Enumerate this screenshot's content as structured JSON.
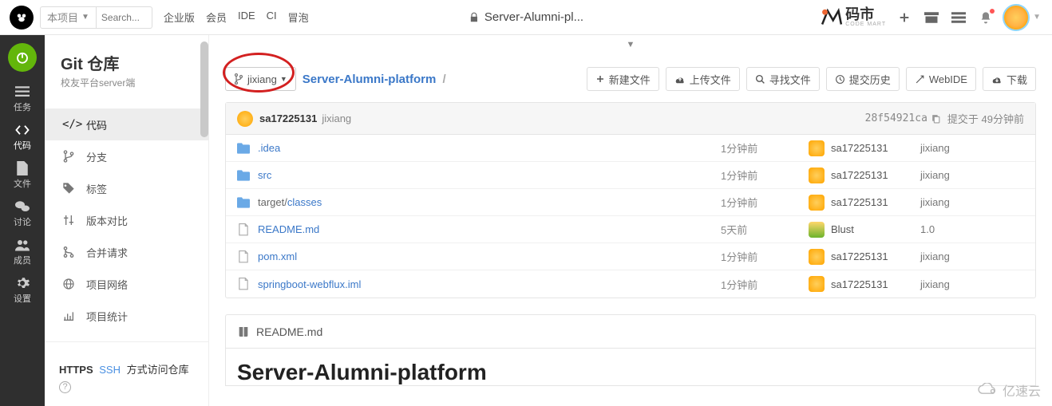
{
  "header": {
    "project_selector": "本项目",
    "search_placeholder": "Search...",
    "nav": [
      "企业版",
      "会员",
      "IDE",
      "CI",
      "冒泡"
    ],
    "title": "Server-Alumni-pl...",
    "market_label": "码市",
    "market_sub": "CODE MART"
  },
  "rail": {
    "items": [
      {
        "label": "任务"
      },
      {
        "label": "代码"
      },
      {
        "label": "文件"
      },
      {
        "label": "讨论"
      },
      {
        "label": "成员"
      },
      {
        "label": "设置"
      }
    ]
  },
  "sidebar": {
    "title": "Git 仓库",
    "subtitle": "校友平台server端",
    "items": [
      {
        "label": "代码"
      },
      {
        "label": "分支"
      },
      {
        "label": "标签"
      },
      {
        "label": "版本对比"
      },
      {
        "label": "合并请求"
      },
      {
        "label": "项目网络"
      },
      {
        "label": "项目统计"
      }
    ],
    "clone": {
      "https": "HTTPS",
      "ssh": "SSH",
      "suffix": "方式访问仓库"
    }
  },
  "toolbar": {
    "branch": "jixiang",
    "breadcrumb_root": "Server-Alumni-platform",
    "actions": {
      "new_file": "新建文件",
      "upload": "上传文件",
      "find": "寻找文件",
      "history": "提交历史",
      "webide": "WebIDE",
      "download": "下载"
    }
  },
  "commit_bar": {
    "user": "sa17225131",
    "branch": "jixiang",
    "sha": "28f54921ca",
    "time": "提交于 49分钟前"
  },
  "files": [
    {
      "type": "folder",
      "name": ".idea",
      "time": "1分钟前",
      "author": "sa17225131",
      "msg": "jixiang",
      "av": "orange"
    },
    {
      "type": "folder",
      "name": "src",
      "time": "1分钟前",
      "author": "sa17225131",
      "msg": "jixiang",
      "av": "orange"
    },
    {
      "type": "folder",
      "prefix": "target/",
      "name": "classes",
      "time": "1分钟前",
      "author": "sa17225131",
      "msg": "jixiang",
      "av": "orange"
    },
    {
      "type": "file",
      "name": "README.md",
      "time": "5天前",
      "author": "Blust",
      "msg": "1.0",
      "av": "pine"
    },
    {
      "type": "file",
      "name": "pom.xml",
      "time": "1分钟前",
      "author": "sa17225131",
      "msg": "jixiang",
      "av": "orange"
    },
    {
      "type": "file",
      "name": "springboot-webflux.iml",
      "time": "1分钟前",
      "author": "sa17225131",
      "msg": "jixiang",
      "av": "orange"
    }
  ],
  "readme": {
    "filename": "README.md",
    "heading": "Server-Alumni-platform"
  },
  "watermark": "亿速云"
}
